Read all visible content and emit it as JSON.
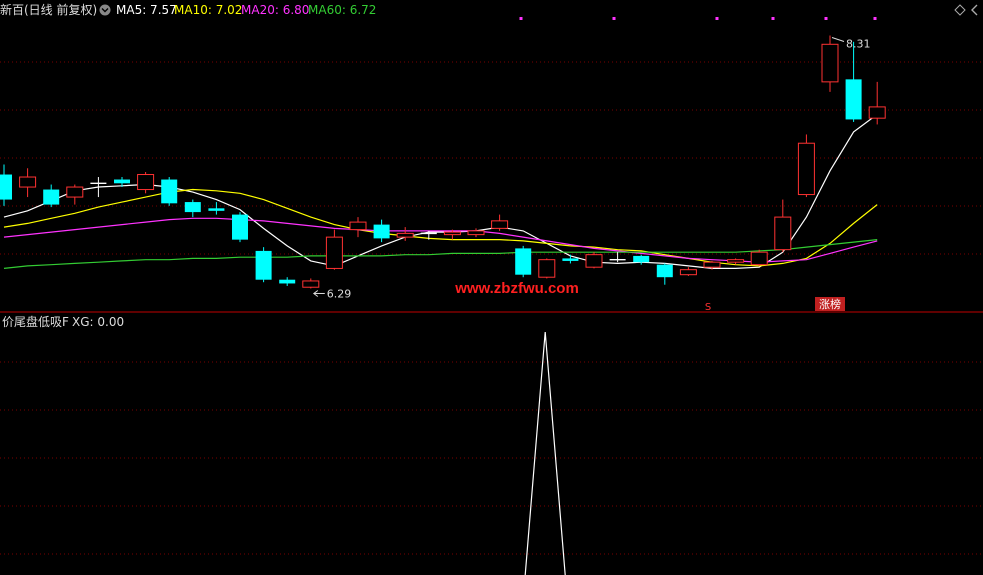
{
  "header": {
    "title": "新百(日线 前复权)",
    "ma": [
      {
        "label": "MA5: 7.57",
        "color": "#ffffff"
      },
      {
        "label": "MA10: 7.02",
        "color": "#ffff00"
      },
      {
        "label": "MA20: 6.80",
        "color": "#ff33ff"
      },
      {
        "label": "MA60: 6.72",
        "color": "#33cc33"
      }
    ],
    "dropdown_icon": "circle-chevron-down-icon",
    "toolbar_icons": [
      "diamond-expand-icon",
      "chevron-left-icon"
    ]
  },
  "watermark": "www.zbzfwu.com",
  "annotations": {
    "low_label": "6.29",
    "high_label": "8.31",
    "limit_up_badge": "涨榜",
    "signal_marker": "S"
  },
  "colors": {
    "up": "#ff3232",
    "down": "#00ffff",
    "flat": "#ffffff",
    "ma5": "#ffffff",
    "ma10": "#ffff00",
    "ma20": "#ff33ff",
    "ma60": "#33cc33",
    "grid": "#7a0000",
    "indicator": "#ffffff",
    "watermark": "#ff2020",
    "badge": "#c02020"
  },
  "indicator": {
    "title": "价尾盘低吸F",
    "value_label": "XG: 0.00",
    "peak_index": 22,
    "peak_value": 1
  },
  "chart_data": {
    "type": "candlestick",
    "price_range": [
      6.15,
      8.45
    ],
    "candles": [
      {
        "o": 7.2,
        "h": 7.28,
        "l": 6.95,
        "c": 7.0
      },
      {
        "o": 7.1,
        "h": 7.25,
        "l": 7.02,
        "c": 7.18
      },
      {
        "o": 7.08,
        "h": 7.12,
        "l": 6.94,
        "c": 6.96
      },
      {
        "o": 7.02,
        "h": 7.12,
        "l": 6.96,
        "c": 7.1
      },
      {
        "o": 7.13,
        "h": 7.18,
        "l": 7.02,
        "c": 7.13
      },
      {
        "o": 7.16,
        "h": 7.18,
        "l": 7.1,
        "c": 7.13
      },
      {
        "o": 7.08,
        "h": 7.22,
        "l": 7.05,
        "c": 7.2
      },
      {
        "o": 7.16,
        "h": 7.18,
        "l": 6.95,
        "c": 6.97
      },
      {
        "o": 6.98,
        "h": 7.0,
        "l": 6.86,
        "c": 6.9
      },
      {
        "o": 6.93,
        "h": 6.98,
        "l": 6.88,
        "c": 6.91
      },
      {
        "o": 6.88,
        "h": 6.9,
        "l": 6.66,
        "c": 6.68
      },
      {
        "o": 6.59,
        "h": 6.62,
        "l": 6.34,
        "c": 6.36
      },
      {
        "o": 6.36,
        "h": 6.38,
        "l": 6.31,
        "c": 6.33
      },
      {
        "o": 6.3,
        "h": 6.37,
        "l": 6.29,
        "c": 6.35
      },
      {
        "o": 6.45,
        "h": 6.76,
        "l": 6.44,
        "c": 6.7
      },
      {
        "o": 6.76,
        "h": 6.86,
        "l": 6.7,
        "c": 6.82
      },
      {
        "o": 6.8,
        "h": 6.84,
        "l": 6.66,
        "c": 6.69
      },
      {
        "o": 6.7,
        "h": 6.78,
        "l": 6.67,
        "c": 6.73
      },
      {
        "o": 6.73,
        "h": 6.75,
        "l": 6.68,
        "c": 6.73
      },
      {
        "o": 6.72,
        "h": 6.76,
        "l": 6.68,
        "c": 6.74
      },
      {
        "o": 6.72,
        "h": 6.77,
        "l": 6.7,
        "c": 6.75
      },
      {
        "o": 6.77,
        "h": 6.88,
        "l": 6.75,
        "c": 6.83
      },
      {
        "o": 6.61,
        "h": 6.63,
        "l": 6.38,
        "c": 6.4
      },
      {
        "o": 6.38,
        "h": 6.53,
        "l": 6.37,
        "c": 6.52
      },
      {
        "o": 6.53,
        "h": 6.56,
        "l": 6.49,
        "c": 6.51
      },
      {
        "o": 6.46,
        "h": 6.58,
        "l": 6.45,
        "c": 6.56
      },
      {
        "o": 6.52,
        "h": 6.58,
        "l": 6.5,
        "c": 6.52
      },
      {
        "o": 6.55,
        "h": 6.56,
        "l": 6.48,
        "c": 6.5
      },
      {
        "o": 6.48,
        "h": 6.49,
        "l": 6.32,
        "c": 6.38
      },
      {
        "o": 6.4,
        "h": 6.46,
        "l": 6.39,
        "c": 6.44
      },
      {
        "o": 6.46,
        "h": 6.51,
        "l": 6.44,
        "c": 6.5
      },
      {
        "o": 6.5,
        "h": 6.53,
        "l": 6.48,
        "c": 6.52
      },
      {
        "o": 6.48,
        "h": 6.6,
        "l": 6.47,
        "c": 6.58
      },
      {
        "o": 6.6,
        "h": 7.0,
        "l": 6.58,
        "c": 6.86
      },
      {
        "o": 7.04,
        "h": 7.52,
        "l": 7.02,
        "c": 7.45
      },
      {
        "o": 7.94,
        "h": 8.31,
        "l": 7.86,
        "c": 8.24
      },
      {
        "o": 7.96,
        "h": 8.26,
        "l": 7.62,
        "c": 7.64
      },
      {
        "o": 7.65,
        "h": 7.94,
        "l": 7.6,
        "c": 7.74
      }
    ],
    "ma": {
      "MA5": [
        6.86,
        6.91,
        6.99,
        7.07,
        7.1,
        7.11,
        7.12,
        7.1,
        7.06,
        7.0,
        6.92,
        6.77,
        6.63,
        6.51,
        6.47,
        6.55,
        6.63,
        6.7,
        6.74,
        6.74,
        6.75,
        6.78,
        6.75,
        6.65,
        6.55,
        6.5,
        6.49,
        6.5,
        6.49,
        6.47,
        6.45,
        6.45,
        6.46,
        6.58,
        6.86,
        7.23,
        7.54,
        7.68
      ],
      "MA10": [
        6.78,
        6.81,
        6.85,
        6.89,
        6.94,
        6.98,
        7.02,
        7.06,
        7.08,
        7.07,
        7.05,
        7.0,
        6.93,
        6.86,
        6.8,
        6.76,
        6.73,
        6.71,
        6.69,
        6.68,
        6.68,
        6.68,
        6.67,
        6.65,
        6.63,
        6.62,
        6.6,
        6.59,
        6.56,
        6.53,
        6.5,
        6.48,
        6.47,
        6.49,
        6.53,
        6.65,
        6.81,
        6.96
      ],
      "MA20": [
        6.7,
        6.72,
        6.74,
        6.76,
        6.78,
        6.8,
        6.82,
        6.84,
        6.85,
        6.85,
        6.84,
        6.83,
        6.81,
        6.79,
        6.77,
        6.76,
        6.75,
        6.75,
        6.75,
        6.75,
        6.75,
        6.73,
        6.7,
        6.67,
        6.64,
        6.61,
        6.59,
        6.57,
        6.55,
        6.53,
        6.52,
        6.51,
        6.5,
        6.51,
        6.52,
        6.57,
        6.62,
        6.67
      ],
      "MA60": [
        6.45,
        6.47,
        6.48,
        6.49,
        6.5,
        6.51,
        6.52,
        6.52,
        6.53,
        6.53,
        6.54,
        6.54,
        6.54,
        6.55,
        6.55,
        6.55,
        6.55,
        6.56,
        6.56,
        6.57,
        6.57,
        6.57,
        6.58,
        6.58,
        6.58,
        6.58,
        6.58,
        6.58,
        6.58,
        6.58,
        6.58,
        6.58,
        6.59,
        6.6,
        6.62,
        6.64,
        6.66,
        6.68
      ]
    }
  }
}
